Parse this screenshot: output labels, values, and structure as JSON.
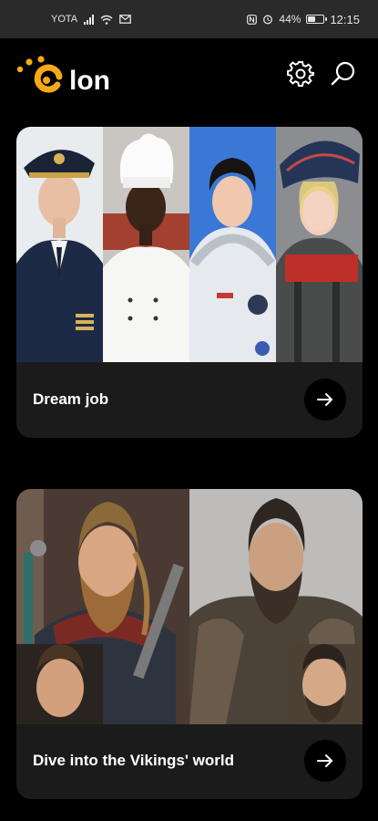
{
  "status_bar": {
    "carrier": "YOTA",
    "battery": "44%",
    "battery_level": 0.44,
    "time": "12:15"
  },
  "header": {
    "logo_text": "lon",
    "logo_icon": "sun-c-logo",
    "settings_icon": "gear-icon",
    "search_icon": "search-icon"
  },
  "cards": [
    {
      "title": "Dream job",
      "action_icon": "arrow-right-icon"
    },
    {
      "title": "Dive into the Vikings' world",
      "action_icon": "arrow-right-icon"
    }
  ],
  "colors": {
    "background": "#000000",
    "card": "#1b1b1b",
    "accent": "#f6a917",
    "status_bar": "#2a2a2a"
  }
}
